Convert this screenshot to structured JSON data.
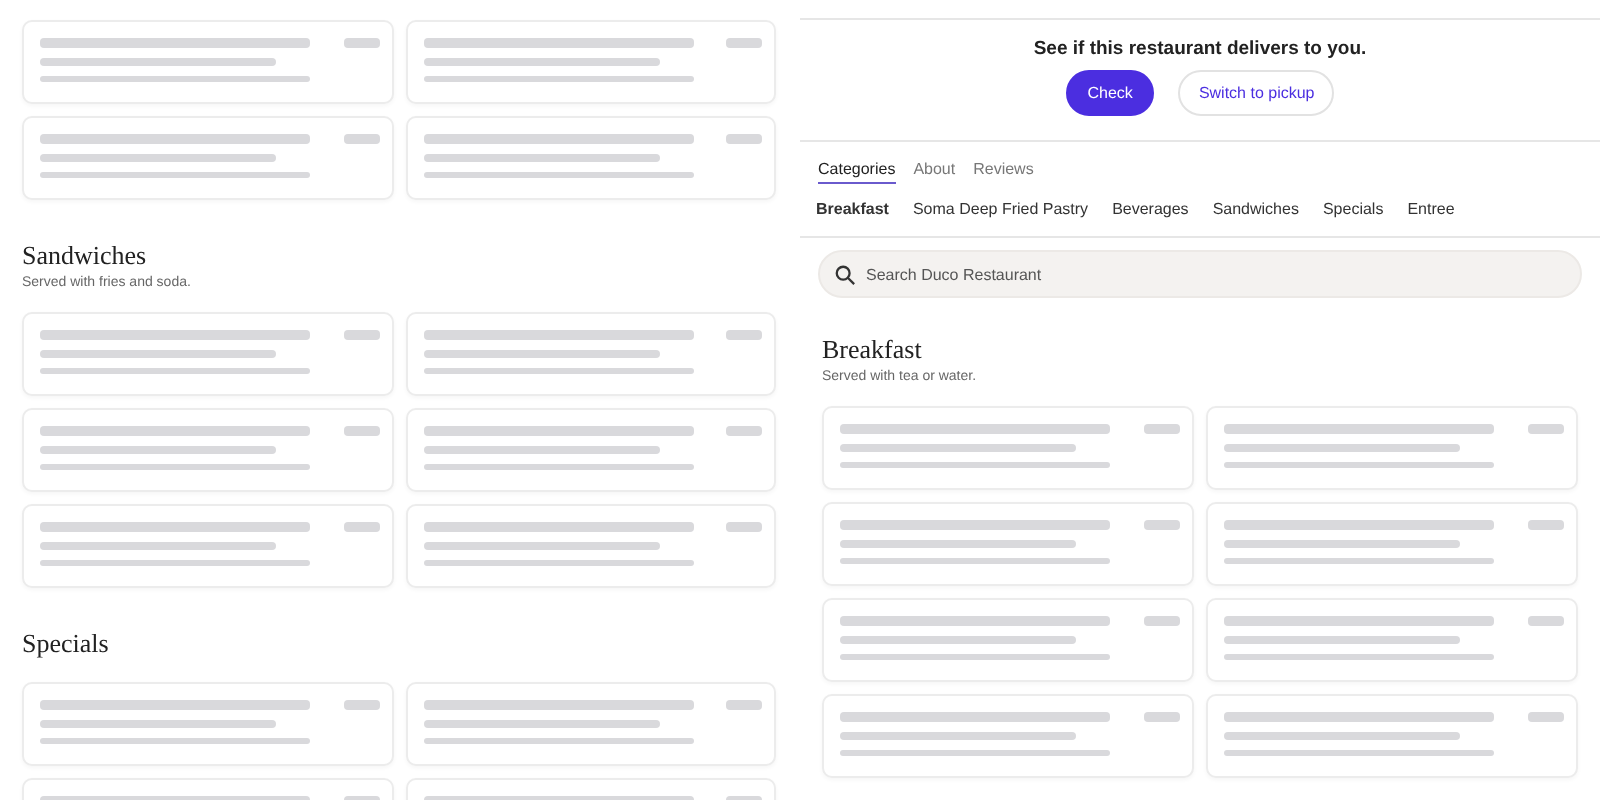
{
  "left_menu": {
    "sections": [
      {
        "cards": [
          {
            "kind": "skeleton"
          },
          {
            "kind": "skeleton"
          },
          {
            "kind": "skeleton"
          },
          {
            "kind": "skeleton"
          }
        ]
      },
      {
        "title": "Sandwiches",
        "subtitle": "Served with fries and soda.",
        "cards": [
          {
            "kind": "skeleton"
          },
          {
            "kind": "skeleton"
          },
          {
            "kind": "skeleton"
          },
          {
            "kind": "skeleton"
          },
          {
            "kind": "skeleton"
          },
          {
            "kind": "skeleton"
          }
        ]
      },
      {
        "title": "Specials",
        "cards": [
          {
            "kind": "skeleton"
          },
          {
            "kind": "skeleton"
          },
          {
            "kind": "skeleton"
          },
          {
            "kind": "skeleton"
          }
        ]
      }
    ]
  },
  "delivery": {
    "prompt": "See if this restaurant delivers to you.",
    "buttons": [
      {
        "label": "Check",
        "kind": "primary"
      },
      {
        "label": "Switch to pickup",
        "kind": "secondary"
      }
    ]
  },
  "tabs": [
    {
      "label": "Categories",
      "selected": true
    },
    {
      "label": "About",
      "selected": false
    },
    {
      "label": "Reviews",
      "selected": false
    }
  ],
  "categories": [
    {
      "label": "Breakfast",
      "selected": true
    },
    {
      "label": "Soma Deep Fried Pastry",
      "selected": false
    },
    {
      "label": "Beverages",
      "selected": false
    },
    {
      "label": "Sandwiches",
      "selected": false
    },
    {
      "label": "Specials",
      "selected": false
    },
    {
      "label": "Entree",
      "selected": false
    }
  ],
  "search": {
    "placeholder": "Search Duco Restaurant"
  },
  "right_menu": {
    "sections": [
      {
        "title": "Breakfast",
        "subtitle": "Served with tea or water.",
        "cards": [
          {
            "kind": "skeleton"
          },
          {
            "kind": "skeleton"
          },
          {
            "kind": "skeleton"
          },
          {
            "kind": "skeleton"
          },
          {
            "kind": "skeleton"
          },
          {
            "kind": "skeleton"
          },
          {
            "kind": "skeleton"
          },
          {
            "kind": "skeleton"
          }
        ]
      }
    ]
  }
}
